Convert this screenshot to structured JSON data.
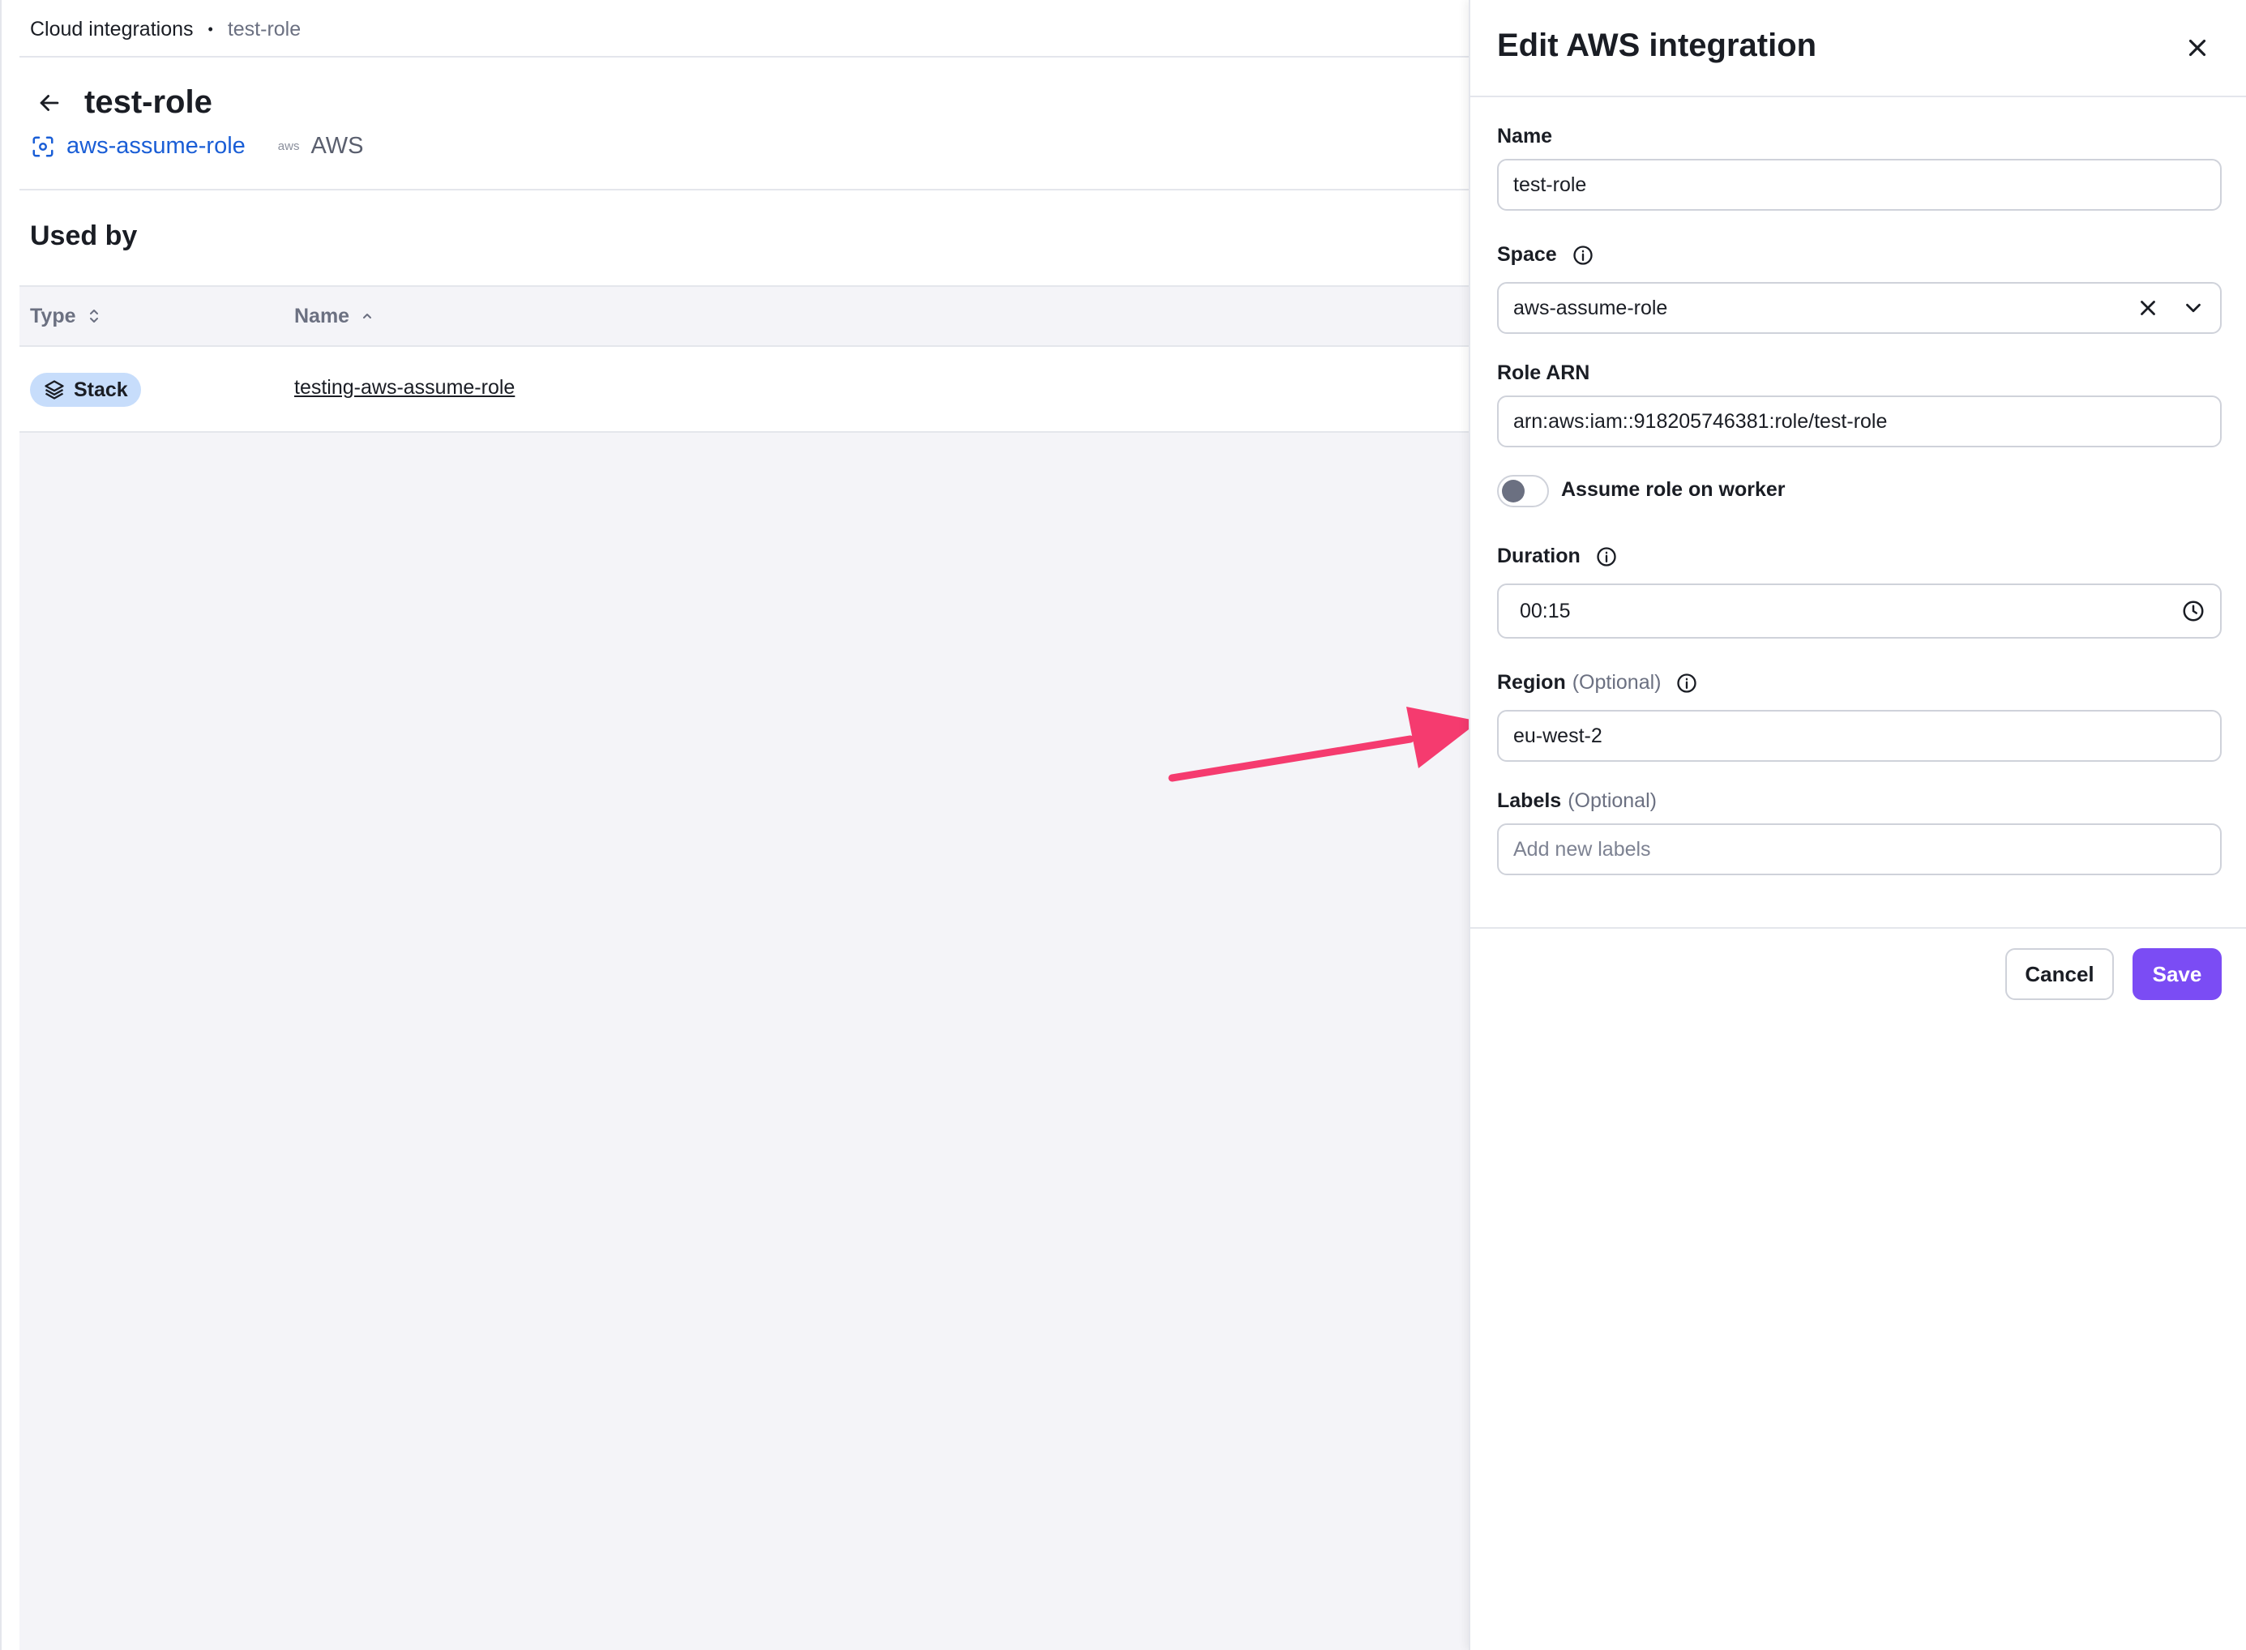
{
  "breadcrumb": {
    "root": "Cloud integrations",
    "separator": "•",
    "current": "test-role"
  },
  "page": {
    "title": "test-role",
    "space_link": "aws-assume-role",
    "provider_logo": "aws",
    "provider": "AWS",
    "section_title": "Used by"
  },
  "table": {
    "columns": [
      "Type",
      "Name"
    ],
    "rows": [
      {
        "type": "Stack",
        "name": "testing-aws-assume-role"
      }
    ]
  },
  "drawer": {
    "title": "Edit AWS integration",
    "fields": {
      "name": {
        "label": "Name",
        "value": "test-role"
      },
      "space": {
        "label": "Space",
        "value": "aws-assume-role"
      },
      "role_arn": {
        "label": "Role ARN",
        "value": "arn:aws:iam::918205746381:role/test-role"
      },
      "assume_role": {
        "label": "Assume role on worker",
        "enabled": false
      },
      "duration": {
        "label": "Duration",
        "value": "00:15"
      },
      "region": {
        "label": "Region",
        "optional": "(Optional)",
        "value": "eu-west-2"
      },
      "labels": {
        "label": "Labels",
        "optional": "(Optional)",
        "placeholder": "Add new labels"
      }
    },
    "cancel_label": "Cancel",
    "save_label": "Save"
  },
  "colors": {
    "accent": "#7b4cf4",
    "link": "#1a5ed6",
    "badge": "#c7ddfb",
    "annotation_arrow": "#f53b6f"
  },
  "icons": [
    "back-arrow-icon",
    "space-icon",
    "aws-logo-icon",
    "sort-icon",
    "sort-asc-icon",
    "stack-icon",
    "close-icon",
    "info-icon",
    "clear-icon",
    "chevron-down-icon",
    "clock-icon"
  ]
}
